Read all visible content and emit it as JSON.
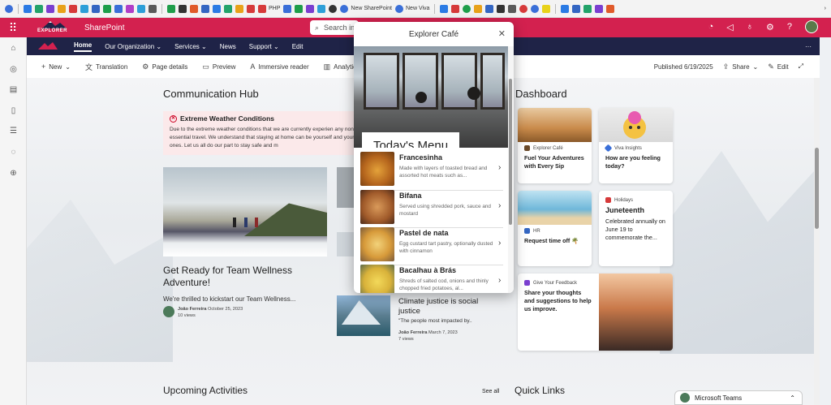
{
  "bookmarks": {
    "php_label": "PHP",
    "new_sharepoint_label": "New SharePoint",
    "new_viva_label": "New Viva"
  },
  "suite": {
    "logo_text": "EXPLORER",
    "app_name": "SharePoint",
    "search_placeholder": "Search in"
  },
  "nav": {
    "items": [
      "Home",
      "Our Organization",
      "Services",
      "News",
      "Support",
      "Edit"
    ],
    "more": "···"
  },
  "commands": {
    "new": "New",
    "translation": "Translation",
    "page_details": "Page details",
    "preview": "Preview",
    "immersive_reader": "Immersive reader",
    "analytics": "Analytics",
    "published": "Published 6/19/2025",
    "share": "Share",
    "edit": "Edit"
  },
  "comm_hub": {
    "title": "Communication Hub",
    "alert_title": "Extreme Weather Conditions",
    "alert_body": "Due to the extreme weather conditions that we are currently experien any non-essential travel. We understand that staying at home can be yourself and your loved ones. Let us all do our part to stay safe and m",
    "hero_title": "Get Ready for Team Wellness Adventure!",
    "hero_desc": "We're thrilled to kickstart our Team Wellness...",
    "hero_author": "João Ferreira",
    "hero_date": "October 25, 2023",
    "hero_views": "10 views",
    "news2_title": "Climate justice is social justice",
    "news2_desc": "\"The people most impacted by..",
    "news2_author": "João Ferreira",
    "news2_date": "March 7, 2023",
    "news2_views": "7 views"
  },
  "dashboard": {
    "title": "Dashboard",
    "cards": [
      {
        "tag": "Explorer Café",
        "text": "Fuel Your Adventures with Every Sip"
      },
      {
        "tag": "Viva Insights",
        "text": "How are you feeling today?"
      },
      {
        "tag": "HR",
        "text": "Request time off 🌴"
      },
      {
        "tag": "Holidays",
        "text": "Juneteenth",
        "sub": "Celebrated annually on June 19 to commemorate the..."
      },
      {
        "tag": "Give Your Feedback",
        "text": "Share your thoughts and suggestions to help us improve."
      }
    ]
  },
  "bottom": {
    "upcoming": "Upcoming Activities",
    "see_all": "See all",
    "quick_links": "Quick Links",
    "teams": "Microsoft Teams"
  },
  "popup": {
    "title": "Explorer Café",
    "banner": "Today's Menu",
    "items": [
      {
        "name": "Francesinha",
        "desc": "Made with layers of toasted bread and assorted hot meats such as..."
      },
      {
        "name": "Bifana",
        "desc": "Served using shredded pork, sauce and mostard"
      },
      {
        "name": "Pastel de nata",
        "desc": "Egg custard tart pastry, optionally dusted with cinnamon"
      },
      {
        "name": "Bacalhau à Brás",
        "desc": "Shreds of salted cod, onions and thinly chopped fried potatoes, al..."
      }
    ]
  },
  "colors": {
    "suite_red": "#d3214f",
    "nav_navy": "#1f2347"
  }
}
